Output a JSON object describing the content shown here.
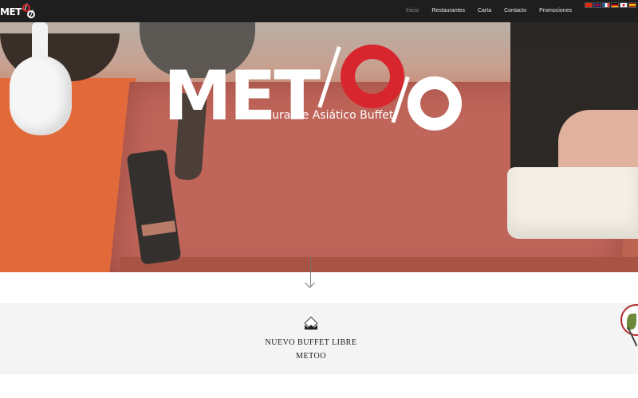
{
  "header": {
    "logo_text": "MET",
    "nav": [
      {
        "label": "Inicio",
        "active": true
      },
      {
        "label": "Restaurantes",
        "active": false
      },
      {
        "label": "Carta",
        "active": false
      },
      {
        "label": "Contacto",
        "active": false
      },
      {
        "label": "Promociones",
        "active": false
      }
    ],
    "flags": [
      "china-flag-icon",
      "uk-flag-icon",
      "france-flag-icon",
      "germany-flag-icon",
      "japan-flag-icon",
      "spain-flag-icon"
    ]
  },
  "hero": {
    "brand_text": "MET",
    "tagline": "Restaurante Asiático Buffet"
  },
  "buffet": {
    "title": "NUEVO BUFFET LIBRE",
    "subtitle": "METOO"
  },
  "colors": {
    "topbar": "#1e1e1e",
    "brand_red": "#d8262e",
    "nav_active": "#8e8e8e",
    "section_bg": "#f4f4f4"
  }
}
